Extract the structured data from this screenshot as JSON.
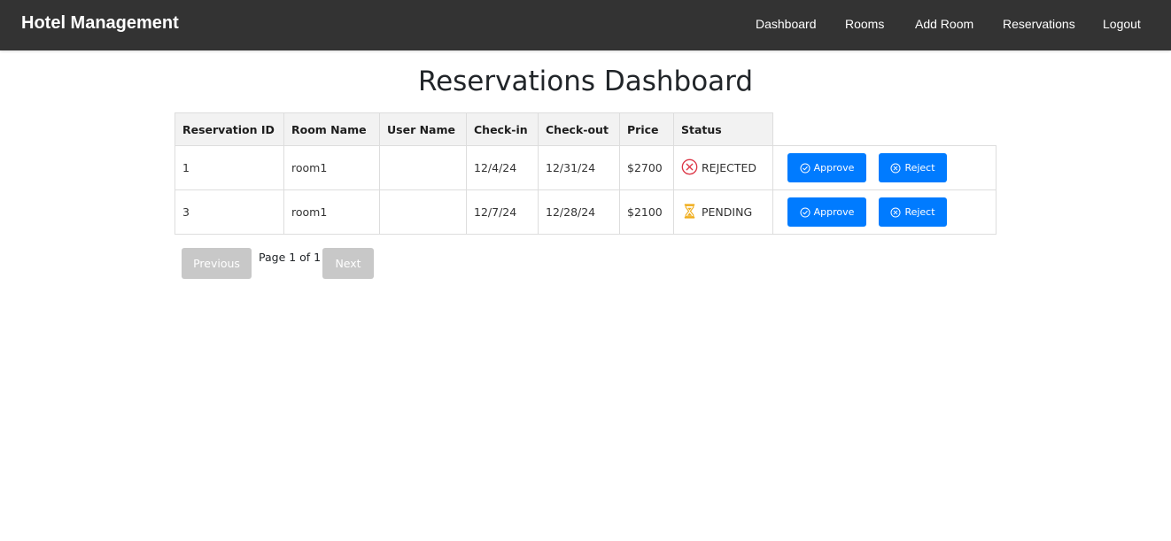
{
  "navbar": {
    "brand": "Hotel Management",
    "links": [
      {
        "label": "Dashboard"
      },
      {
        "label": "Rooms"
      },
      {
        "label": "Add Room"
      },
      {
        "label": "Reservations"
      },
      {
        "label": "Logout"
      }
    ]
  },
  "page": {
    "title": "Reservations Dashboard"
  },
  "table": {
    "headers": [
      "Reservation ID",
      "Room Name",
      "User Name",
      "Check-in",
      "Check-out",
      "Price",
      "Status"
    ],
    "rows": [
      {
        "id": "1",
        "room": "room1",
        "user": "",
        "checkin": "12/4/24",
        "checkout": "12/31/24",
        "price": "$2700",
        "status": "REJECTED",
        "status_icon": "x-circle-icon",
        "approve_label": "Approve",
        "reject_label": "Reject"
      },
      {
        "id": "3",
        "room": "room1",
        "user": "",
        "checkin": "12/7/24",
        "checkout": "12/28/24",
        "price": "$2100",
        "status": "PENDING",
        "status_icon": "hourglass-icon",
        "approve_label": "Approve",
        "reject_label": "Reject"
      }
    ]
  },
  "pagination": {
    "previous_label": "Previous",
    "page_info": "Page 1 of 1",
    "next_label": "Next"
  },
  "colors": {
    "navbar_bg": "#333333",
    "primary": "#007bff",
    "rejected": "#dc3545",
    "pending": "#f0ad1c",
    "disabled": "#c8c8c8"
  }
}
